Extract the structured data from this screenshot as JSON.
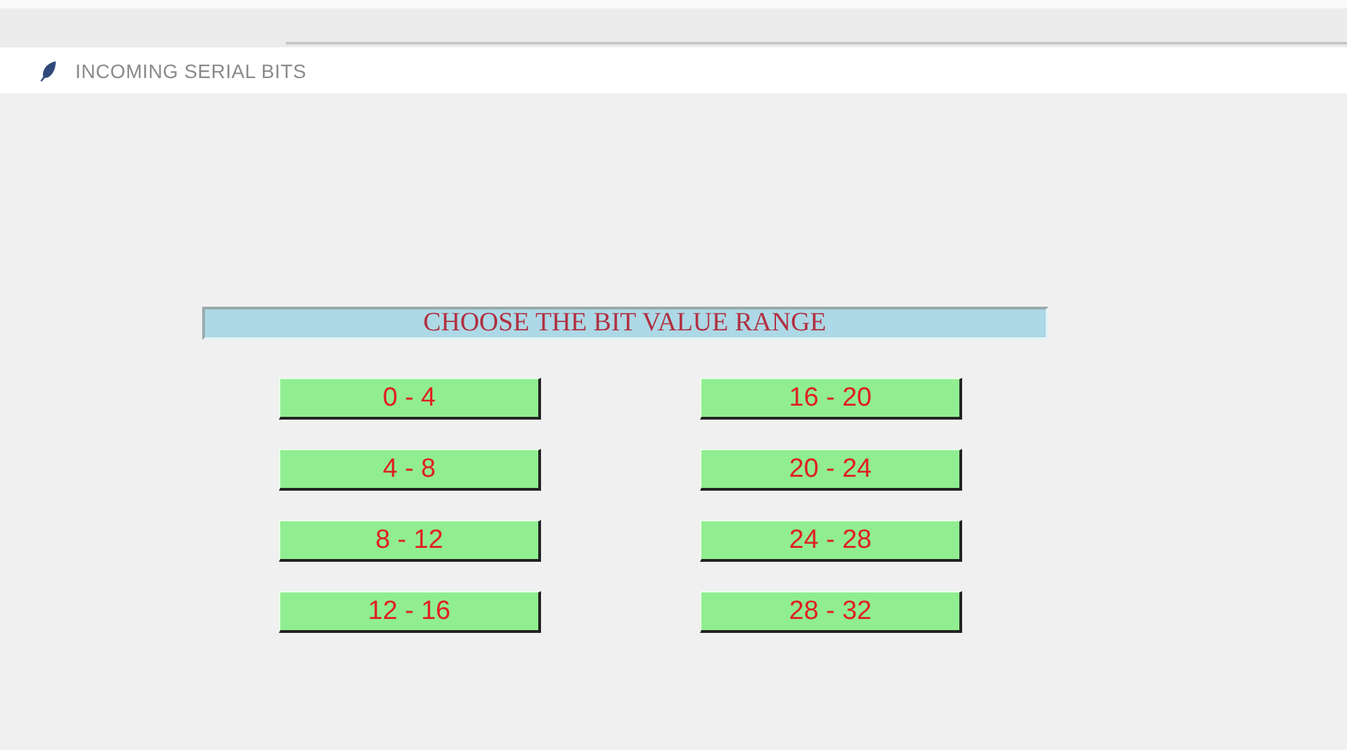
{
  "window": {
    "title": "INCOMING SERIAL BITS"
  },
  "heading": "CHOOSE THE BIT VALUE RANGE",
  "buttons": [
    {
      "label": "0 - 4"
    },
    {
      "label": "16 - 20"
    },
    {
      "label": "4 - 8"
    },
    {
      "label": "20 - 24"
    },
    {
      "label": "8 - 12"
    },
    {
      "label": "24 - 28"
    },
    {
      "label": "12 - 16"
    },
    {
      "label": "28 - 32"
    }
  ]
}
